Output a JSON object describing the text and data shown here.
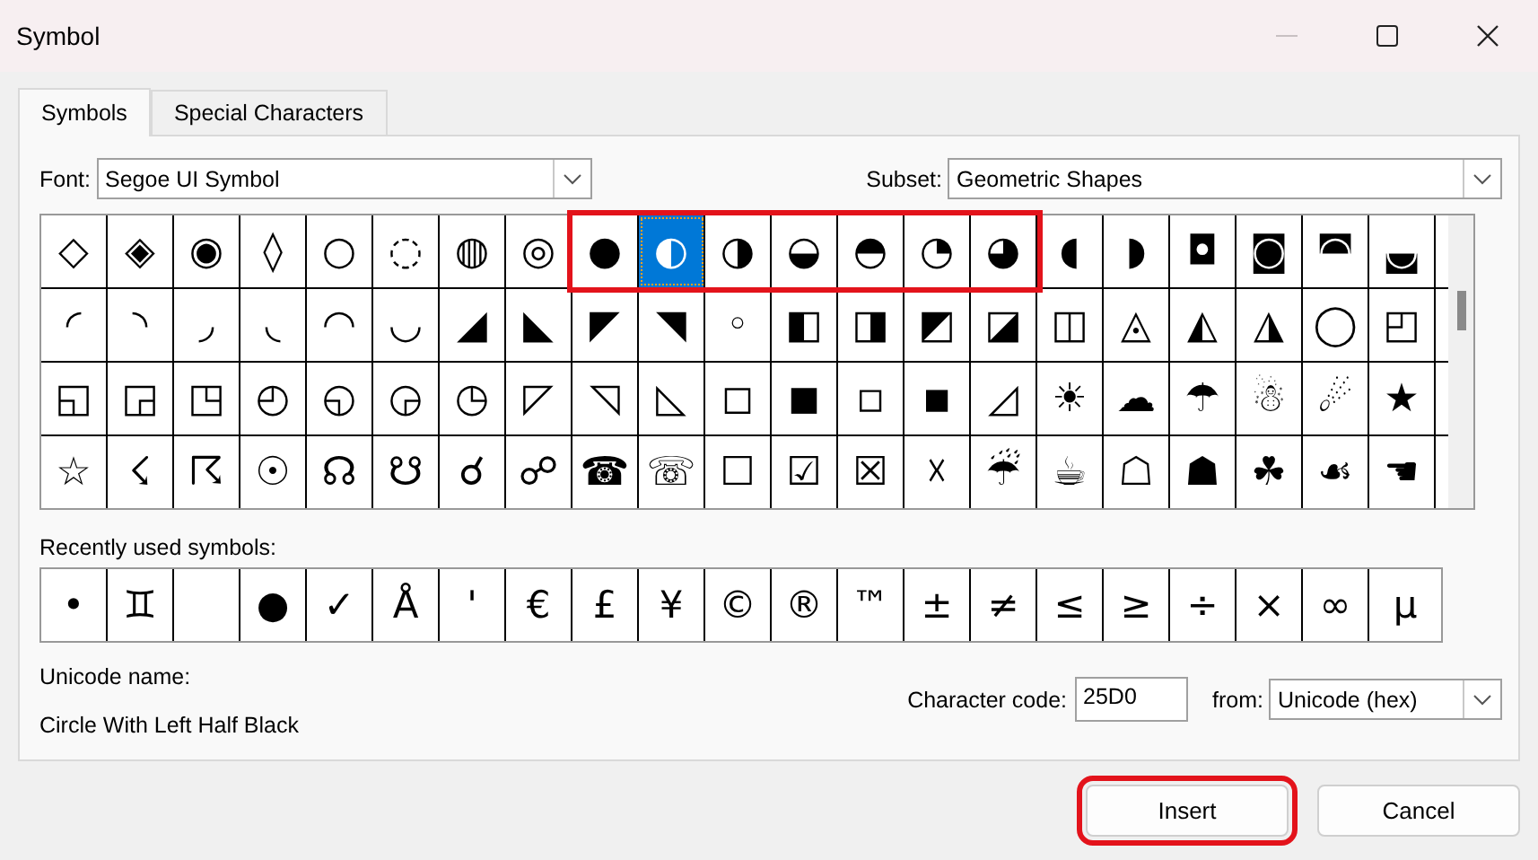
{
  "window": {
    "title": "Symbol",
    "controls": [
      {
        "kind": "minimize",
        "disabled": true
      },
      {
        "kind": "maximize",
        "disabled": false
      },
      {
        "kind": "close",
        "disabled": false
      }
    ]
  },
  "tabs": [
    {
      "label": "Symbols",
      "selected": true
    },
    {
      "label": "Special Characters",
      "selected": false
    }
  ],
  "font": {
    "label": "Font:",
    "value": "Segoe UI Symbol"
  },
  "subset": {
    "label": "Subset:",
    "value": "Geometric Shapes"
  },
  "grid": {
    "rows": [
      {
        "cells": [
          {
            "symbol": "◇",
            "selected": false,
            "outlined": false
          },
          {
            "symbol": "◈",
            "selected": false,
            "outlined": false
          },
          {
            "symbol": "◉",
            "selected": false,
            "outlined": false
          },
          {
            "symbol": "◊",
            "selected": false,
            "outlined": false
          },
          {
            "symbol": "○",
            "selected": false,
            "outlined": false
          },
          {
            "symbol": "◌",
            "selected": false,
            "outlined": false
          },
          {
            "symbol": "◍",
            "selected": false,
            "outlined": false
          },
          {
            "symbol": "◎",
            "selected": false,
            "outlined": false
          },
          {
            "symbol": "●",
            "selected": false,
            "outlined": true
          },
          {
            "symbol": "◐",
            "selected": true,
            "outlined": true
          },
          {
            "symbol": "◑",
            "selected": false,
            "outlined": true
          },
          {
            "symbol": "◒",
            "selected": false,
            "outlined": true
          },
          {
            "symbol": "◓",
            "selected": false,
            "outlined": true
          },
          {
            "symbol": "◔",
            "selected": false,
            "outlined": true
          },
          {
            "symbol": "◕",
            "selected": false,
            "outlined": true
          },
          {
            "symbol": "◖",
            "selected": false,
            "outlined": false
          },
          {
            "symbol": "◗",
            "selected": false,
            "outlined": false
          },
          {
            "symbol": "◘",
            "selected": false,
            "outlined": false
          },
          {
            "symbol": "◙",
            "selected": false,
            "outlined": false
          },
          {
            "symbol": "◚",
            "selected": false,
            "outlined": false
          },
          {
            "symbol": "◛",
            "selected": false,
            "outlined": false
          }
        ]
      },
      {
        "cells": [
          {
            "symbol": "◜",
            "selected": false,
            "outlined": false
          },
          {
            "symbol": "◝",
            "selected": false,
            "outlined": false
          },
          {
            "symbol": "◞",
            "selected": false,
            "outlined": false
          },
          {
            "symbol": "◟",
            "selected": false,
            "outlined": false
          },
          {
            "symbol": "◠",
            "selected": false,
            "outlined": false
          },
          {
            "symbol": "◡",
            "selected": false,
            "outlined": false
          },
          {
            "symbol": "◢",
            "selected": false,
            "outlined": false
          },
          {
            "symbol": "◣",
            "selected": false,
            "outlined": false
          },
          {
            "symbol": "◤",
            "selected": false,
            "outlined": false
          },
          {
            "symbol": "◥",
            "selected": false,
            "outlined": false
          },
          {
            "symbol": "◦",
            "selected": false,
            "outlined": false
          },
          {
            "symbol": "◧",
            "selected": false,
            "outlined": false
          },
          {
            "symbol": "◨",
            "selected": false,
            "outlined": false
          },
          {
            "symbol": "◩",
            "selected": false,
            "outlined": false
          },
          {
            "symbol": "◪",
            "selected": false,
            "outlined": false
          },
          {
            "symbol": "◫",
            "selected": false,
            "outlined": false
          },
          {
            "symbol": "◬",
            "selected": false,
            "outlined": false
          },
          {
            "symbol": "◭",
            "selected": false,
            "outlined": false
          },
          {
            "symbol": "◮",
            "selected": false,
            "outlined": false
          },
          {
            "symbol": "◯",
            "selected": false,
            "outlined": false
          },
          {
            "symbol": "◰",
            "selected": false,
            "outlined": false
          }
        ]
      },
      {
        "cells": [
          {
            "symbol": "◱",
            "selected": false,
            "outlined": false
          },
          {
            "symbol": "◲",
            "selected": false,
            "outlined": false
          },
          {
            "symbol": "◳",
            "selected": false,
            "outlined": false
          },
          {
            "symbol": "◴",
            "selected": false,
            "outlined": false
          },
          {
            "symbol": "◵",
            "selected": false,
            "outlined": false
          },
          {
            "symbol": "◶",
            "selected": false,
            "outlined": false
          },
          {
            "symbol": "◷",
            "selected": false,
            "outlined": false
          },
          {
            "symbol": "◸",
            "selected": false,
            "outlined": false
          },
          {
            "symbol": "◹",
            "selected": false,
            "outlined": false
          },
          {
            "symbol": "◺",
            "selected": false,
            "outlined": false
          },
          {
            "symbol": "◻",
            "selected": false,
            "outlined": false
          },
          {
            "symbol": "◼",
            "selected": false,
            "outlined": false
          },
          {
            "symbol": "◽",
            "selected": false,
            "outlined": false
          },
          {
            "symbol": "◾",
            "selected": false,
            "outlined": false
          },
          {
            "symbol": "◿",
            "selected": false,
            "outlined": false
          },
          {
            "symbol": "☀",
            "selected": false,
            "outlined": false
          },
          {
            "symbol": "☁",
            "selected": false,
            "outlined": false
          },
          {
            "symbol": "☂",
            "selected": false,
            "outlined": false
          },
          {
            "symbol": "☃",
            "selected": false,
            "outlined": false
          },
          {
            "symbol": "☄",
            "selected": false,
            "outlined": false
          },
          {
            "symbol": "★",
            "selected": false,
            "outlined": false
          }
        ]
      },
      {
        "cells": [
          {
            "symbol": "☆",
            "selected": false,
            "outlined": false
          },
          {
            "symbol": "☇",
            "selected": false,
            "outlined": false
          },
          {
            "symbol": "☈",
            "selected": false,
            "outlined": false
          },
          {
            "symbol": "☉",
            "selected": false,
            "outlined": false
          },
          {
            "symbol": "☊",
            "selected": false,
            "outlined": false
          },
          {
            "symbol": "☋",
            "selected": false,
            "outlined": false
          },
          {
            "symbol": "☌",
            "selected": false,
            "outlined": false
          },
          {
            "symbol": "☍",
            "selected": false,
            "outlined": false
          },
          {
            "symbol": "☎",
            "selected": false,
            "outlined": false
          },
          {
            "symbol": "☏",
            "selected": false,
            "outlined": false
          },
          {
            "symbol": "☐",
            "selected": false,
            "outlined": false
          },
          {
            "symbol": "☑",
            "selected": false,
            "outlined": false
          },
          {
            "symbol": "☒",
            "selected": false,
            "outlined": false
          },
          {
            "symbol": "☓",
            "selected": false,
            "outlined": false
          },
          {
            "symbol": "☔",
            "selected": false,
            "outlined": false
          },
          {
            "symbol": "☕",
            "selected": false,
            "outlined": false
          },
          {
            "symbol": "☖",
            "selected": false,
            "outlined": false
          },
          {
            "symbol": "☗",
            "selected": false,
            "outlined": false
          },
          {
            "symbol": "☘",
            "selected": false,
            "outlined": false
          },
          {
            "symbol": "☙",
            "selected": false,
            "outlined": false
          },
          {
            "symbol": "☚",
            "selected": false,
            "outlined": false
          }
        ]
      }
    ]
  },
  "recent": {
    "label": "Recently used symbols:",
    "cells": [
      {
        "symbol": "•"
      },
      {
        "symbol": "♊"
      },
      {},
      {
        "symbol": "●"
      },
      {
        "symbol": "✓"
      },
      {
        "symbol": "Å"
      },
      {
        "symbol": "'"
      },
      {
        "symbol": "€"
      },
      {
        "symbol": "£"
      },
      {
        "symbol": "¥"
      },
      {
        "symbol": "©"
      },
      {
        "symbol": "®"
      },
      {
        "symbol": "™"
      },
      {
        "symbol": "±"
      },
      {
        "symbol": "≠"
      },
      {
        "symbol": "≤"
      },
      {
        "symbol": "≥"
      },
      {
        "symbol": "÷"
      },
      {
        "symbol": "×"
      },
      {
        "symbol": "∞"
      },
      {
        "symbol": "μ"
      }
    ]
  },
  "unicode_name": {
    "label": "Unicode name:",
    "value": "Circle With Left Half Black"
  },
  "character_code": {
    "label": "Character code:",
    "value": "25D0"
  },
  "from": {
    "label": "from:",
    "value": "Unicode (hex)"
  },
  "buttons": [
    {
      "label": "Insert",
      "outlined": true
    },
    {
      "label": "Cancel",
      "outlined": false
    }
  ]
}
